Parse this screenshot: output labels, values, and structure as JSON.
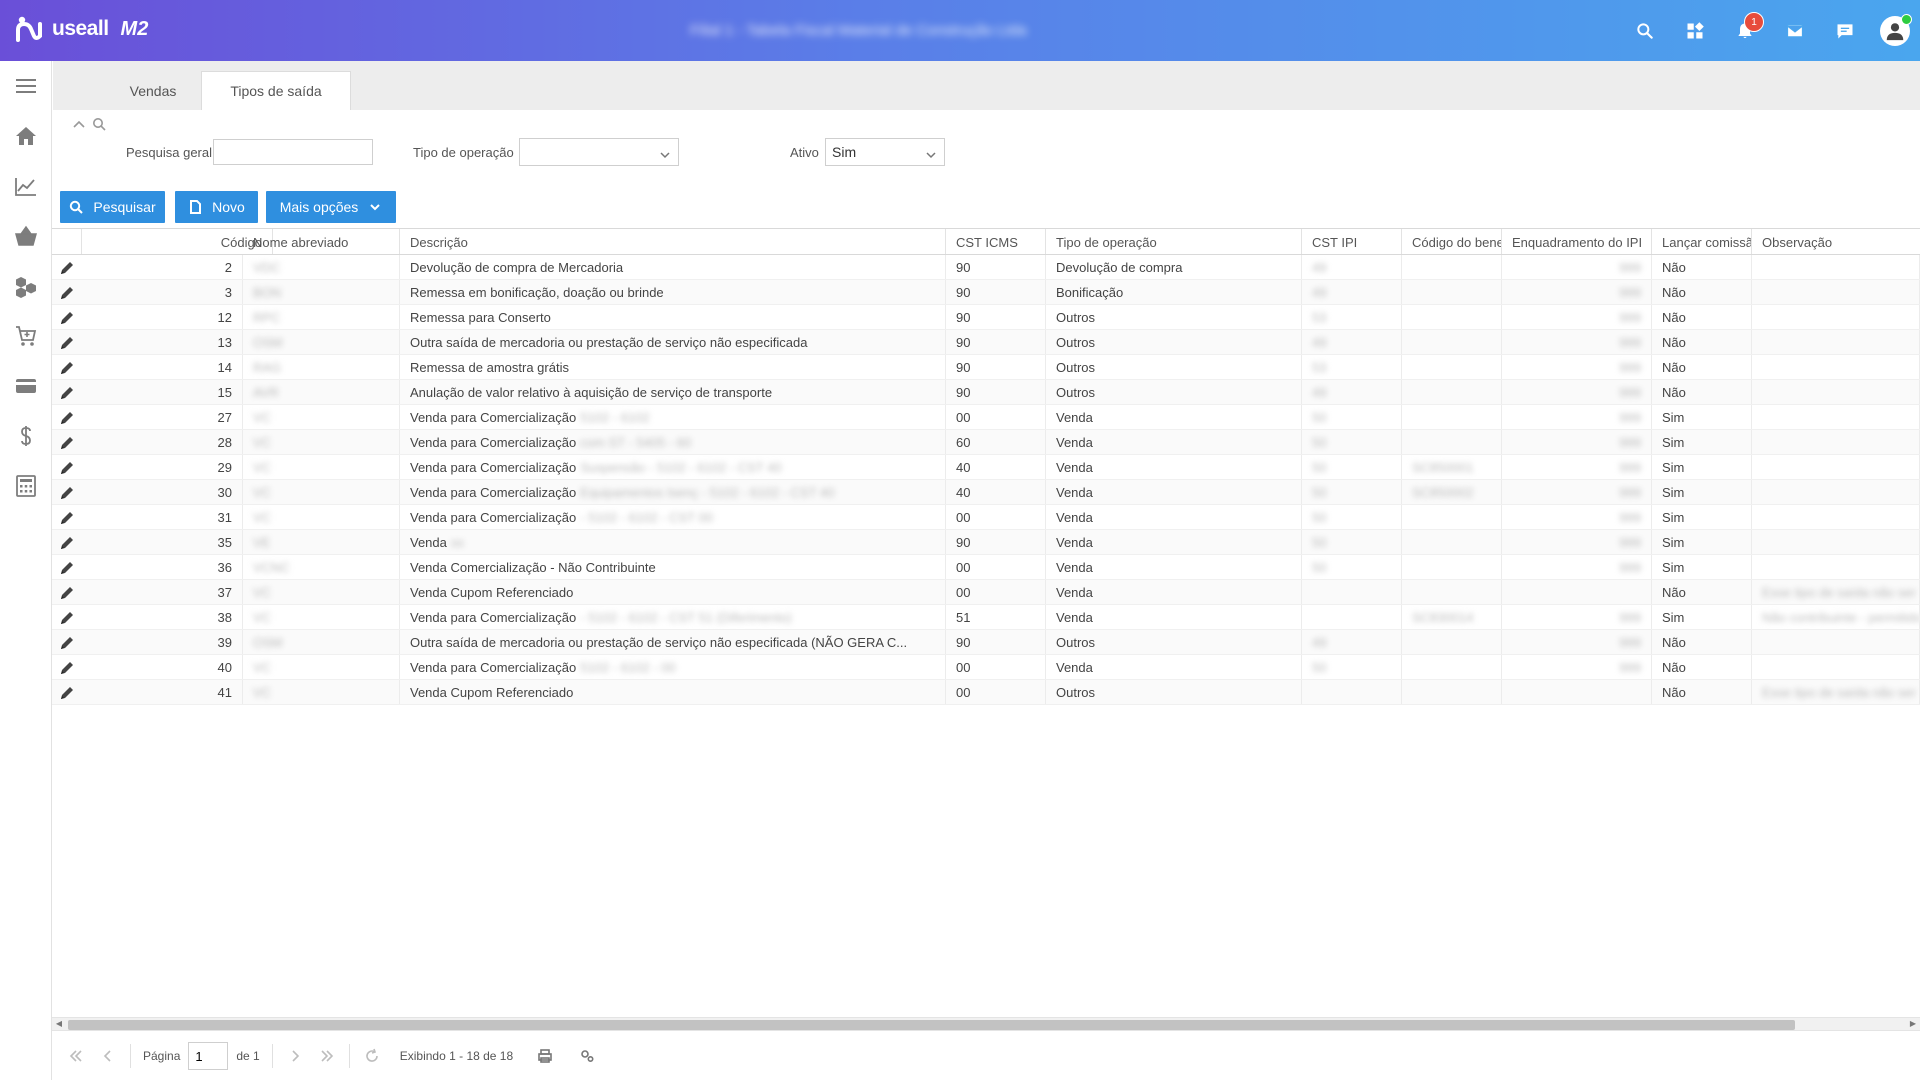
{
  "app": {
    "brand": "useall",
    "brand_suffix": "M2",
    "company": "Filial 1 - Tabela Fiscal Material de Construção Ltda"
  },
  "header": {
    "notifications_count": "1"
  },
  "tabs": [
    {
      "label": "Vendas"
    },
    {
      "label": "Tipos de saída"
    }
  ],
  "filters": {
    "general_search_label": "Pesquisa geral",
    "general_search_value": "",
    "operation_type_label": "Tipo de operação",
    "operation_type_value": "",
    "active_label": "Ativo",
    "active_value": "Sim"
  },
  "toolbar": {
    "search_label": "Pesquisar",
    "new_label": "Novo",
    "more_label": "Mais opções"
  },
  "grid": {
    "columns": [
      "Código",
      "Nome abreviado",
      "Descrição",
      "CST ICMS",
      "Tipo de operação",
      "CST IPI",
      "Código do bene",
      "Enquadramento do IPI",
      "Lançar comissã",
      "Observação"
    ],
    "rows": [
      {
        "codigo": "2",
        "nome": "VDC",
        "descricao": "Devolução de compra de Mercadoria",
        "descricao_extra": "",
        "cst_icms": "90",
        "tipo": "Devolução de compra",
        "cst_ipi": "49",
        "cod_bene": "",
        "enq_ipi": "999",
        "comissao": "Não",
        "obs": ""
      },
      {
        "codigo": "3",
        "nome": "BON",
        "descricao": "Remessa em bonificação, doação ou brinde",
        "descricao_extra": "",
        "cst_icms": "90",
        "tipo": "Bonificação",
        "cst_ipi": "49",
        "cod_bene": "",
        "enq_ipi": "999",
        "comissao": "Não",
        "obs": ""
      },
      {
        "codigo": "12",
        "nome": "RPC",
        "descricao": "Remessa para Conserto",
        "descricao_extra": "",
        "cst_icms": "90",
        "tipo": "Outros",
        "cst_ipi": "53",
        "cod_bene": "",
        "enq_ipi": "999",
        "comissao": "Não",
        "obs": ""
      },
      {
        "codigo": "13",
        "nome": "OSM",
        "descricao": "Outra saída de mercadoria ou prestação de serviço não especificada",
        "descricao_extra": "",
        "cst_icms": "90",
        "tipo": "Outros",
        "cst_ipi": "49",
        "cod_bene": "",
        "enq_ipi": "999",
        "comissao": "Não",
        "obs": ""
      },
      {
        "codigo": "14",
        "nome": "RAG",
        "descricao": "Remessa de amostra grátis",
        "descricao_extra": "",
        "cst_icms": "90",
        "tipo": "Outros",
        "cst_ipi": "53",
        "cod_bene": "",
        "enq_ipi": "999",
        "comissao": "Não",
        "obs": ""
      },
      {
        "codigo": "15",
        "nome": "AVR",
        "descricao": "Anulação de valor relativo à aquisição de serviço de transporte",
        "descricao_extra": "",
        "cst_icms": "90",
        "tipo": "Outros",
        "cst_ipi": "49",
        "cod_bene": "",
        "enq_ipi": "999",
        "comissao": "Não",
        "obs": ""
      },
      {
        "codigo": "27",
        "nome": "VC",
        "descricao": "Venda para Comercialização",
        "descricao_extra": "5102 - 6102",
        "cst_icms": "00",
        "tipo": "Venda",
        "cst_ipi": "50",
        "cod_bene": "",
        "enq_ipi": "999",
        "comissao": "Sim",
        "obs": ""
      },
      {
        "codigo": "28",
        "nome": "VC",
        "descricao": "Venda para Comercialização",
        "descricao_extra": "com ST - 5405 - 60",
        "cst_icms": "60",
        "tipo": "Venda",
        "cst_ipi": "50",
        "cod_bene": "",
        "enq_ipi": "999",
        "comissao": "Sim",
        "obs": ""
      },
      {
        "codigo": "29",
        "nome": "VC",
        "descricao": "Venda para Comercialização",
        "descricao_extra": "Suspensão - 5102 - 6102 - CST 40",
        "cst_icms": "40",
        "tipo": "Venda",
        "cst_ipi": "50",
        "cod_bene": "SC850001",
        "enq_ipi": "999",
        "comissao": "Sim",
        "obs": ""
      },
      {
        "codigo": "30",
        "nome": "VC",
        "descricao": "Venda para Comercialização",
        "descricao_extra": "Equipamentos Isenç - 5102 - 6102 - CST 40",
        "cst_icms": "40",
        "tipo": "Venda",
        "cst_ipi": "50",
        "cod_bene": "SC850002",
        "enq_ipi": "999",
        "comissao": "Sim",
        "obs": ""
      },
      {
        "codigo": "31",
        "nome": "VC",
        "descricao": "Venda para Comercialização",
        "descricao_extra": " - 5102 - 6102 - CST 00",
        "cst_icms": "00",
        "tipo": "Venda",
        "cst_ipi": "50",
        "cod_bene": "",
        "enq_ipi": "999",
        "comissao": "Sim",
        "obs": ""
      },
      {
        "codigo": "35",
        "nome": "VE",
        "descricao": "Venda",
        "descricao_extra": "xx",
        "cst_icms": "90",
        "tipo": "Venda",
        "cst_ipi": "50",
        "cod_bene": "",
        "enq_ipi": "999",
        "comissao": "Sim",
        "obs": ""
      },
      {
        "codigo": "36",
        "nome": "VCNC",
        "descricao": "Venda Comercialização - Não Contribuinte",
        "descricao_extra": "",
        "cst_icms": "00",
        "tipo": "Venda",
        "cst_ipi": "50",
        "cod_bene": "",
        "enq_ipi": "999",
        "comissao": "Sim",
        "obs": ""
      },
      {
        "codigo": "37",
        "nome": "VC",
        "descricao": "Venda Cupom Referenciado",
        "descricao_extra": "",
        "cst_icms": "00",
        "tipo": "Venda",
        "cst_ipi": "",
        "cod_bene": "",
        "enq_ipi": "",
        "comissao": "Não",
        "obs": "Esse tipo de saída não ser"
      },
      {
        "codigo": "38",
        "nome": "VC",
        "descricao": "Venda para Comercialização",
        "descricao_extra": " - 5102 - 6102 - CST 51 (Diferimento)",
        "cst_icms": "51",
        "tipo": "Venda",
        "cst_ipi": "",
        "cod_bene": "SC830014",
        "enq_ipi": "999",
        "comissao": "Sim",
        "obs": "Não contribuinte - permitido"
      },
      {
        "codigo": "39",
        "nome": "OSM",
        "descricao": "Outra saída de mercadoria ou prestação de serviço não especificada (NÃO GERA C...",
        "descricao_extra": "",
        "cst_icms": "90",
        "tipo": "Outros",
        "cst_ipi": "49",
        "cod_bene": "",
        "enq_ipi": "999",
        "comissao": "Não",
        "obs": ""
      },
      {
        "codigo": "40",
        "nome": "VC",
        "descricao": "Venda para Comercialização",
        "descricao_extra": "5102 - 6102 - 00",
        "cst_icms": "00",
        "tipo": "Venda",
        "cst_ipi": "50",
        "cod_bene": "",
        "enq_ipi": "999",
        "comissao": "Não",
        "obs": ""
      },
      {
        "codigo": "41",
        "nome": "VC",
        "descricao": "Venda Cupom Referenciado",
        "descricao_extra": "",
        "cst_icms": "00",
        "tipo": "Outros",
        "cst_ipi": "",
        "cod_bene": "",
        "enq_ipi": "",
        "comissao": "Não",
        "obs": "Esse tipo de saída não ser"
      }
    ]
  },
  "pager": {
    "page_label": "Página",
    "page_value": "1",
    "of_label": "de 1",
    "display_text": "Exibindo 1 - 18 de 18"
  }
}
